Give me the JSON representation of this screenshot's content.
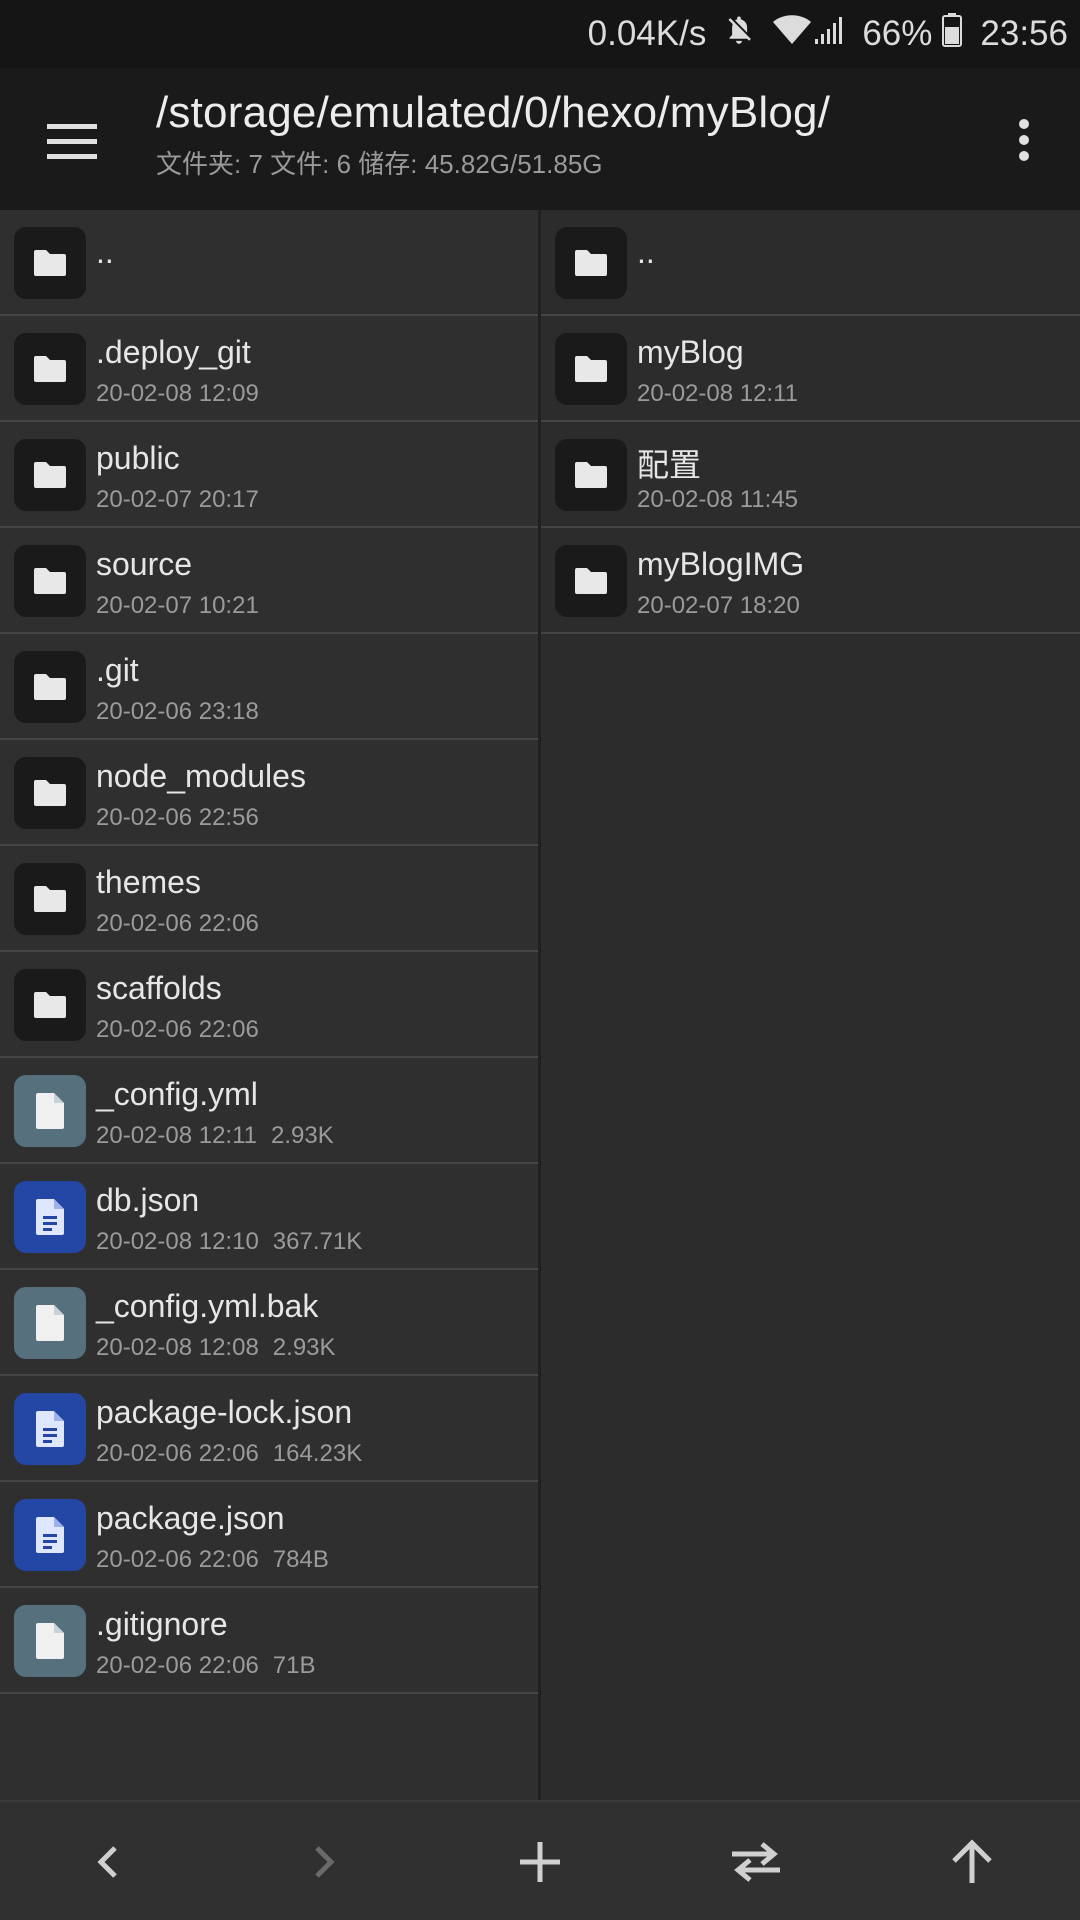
{
  "status_bar": {
    "net_speed": "0.04K/s",
    "battery": "66%",
    "time": "23:56",
    "icons": [
      "bell-off-icon",
      "wifi-icon",
      "signal-icon",
      "battery-icon"
    ]
  },
  "toolbar": {
    "path": "/storage/emulated/0/hexo/myBlog/",
    "summary": "文件夹: 7  文件: 6  储存: 45.82G/51.85G"
  },
  "left_pane": {
    "items": [
      {
        "name": "..",
        "date": "",
        "size": "",
        "type": "folder"
      },
      {
        "name": ".deploy_git",
        "date": "20-02-08 12:09",
        "size": "",
        "type": "folder"
      },
      {
        "name": "public",
        "date": "20-02-07 20:17",
        "size": "",
        "type": "folder"
      },
      {
        "name": "source",
        "date": "20-02-07 10:21",
        "size": "",
        "type": "folder"
      },
      {
        "name": ".git",
        "date": "20-02-06 23:18",
        "size": "",
        "type": "folder"
      },
      {
        "name": "node_modules",
        "date": "20-02-06 22:56",
        "size": "",
        "type": "folder"
      },
      {
        "name": "themes",
        "date": "20-02-06 22:06",
        "size": "",
        "type": "folder"
      },
      {
        "name": "scaffolds",
        "date": "20-02-06 22:06",
        "size": "",
        "type": "folder"
      },
      {
        "name": "_config.yml",
        "date": "20-02-08 12:11",
        "size": "2.93K",
        "type": "file"
      },
      {
        "name": "db.json",
        "date": "20-02-08 12:10",
        "size": "367.71K",
        "type": "json"
      },
      {
        "name": "_config.yml.bak",
        "date": "20-02-08 12:08",
        "size": "2.93K",
        "type": "file"
      },
      {
        "name": "package-lock.json",
        "date": "20-02-06 22:06",
        "size": "164.23K",
        "type": "json"
      },
      {
        "name": "package.json",
        "date": "20-02-06 22:06",
        "size": "784B",
        "type": "json"
      },
      {
        "name": ".gitignore",
        "date": "20-02-06 22:06",
        "size": "71B",
        "type": "file"
      }
    ]
  },
  "right_pane": {
    "items": [
      {
        "name": "..",
        "date": "",
        "size": "",
        "type": "folder"
      },
      {
        "name": "myBlog",
        "date": "20-02-08 12:11",
        "size": "",
        "type": "folder"
      },
      {
        "name": "配置",
        "date": "20-02-08 11:45",
        "size": "",
        "type": "folder"
      },
      {
        "name": "myBlogIMG",
        "date": "20-02-07 18:20",
        "size": "",
        "type": "folder"
      }
    ]
  },
  "bottom_bar": {
    "buttons": [
      "back-icon",
      "forward-icon",
      "add-icon",
      "swap-icon",
      "up-icon"
    ]
  },
  "colors": {
    "folder_icon_bg": "#1a1a1a",
    "file_icon_bg": "#56707e",
    "json_icon_bg": "#2447a6"
  }
}
